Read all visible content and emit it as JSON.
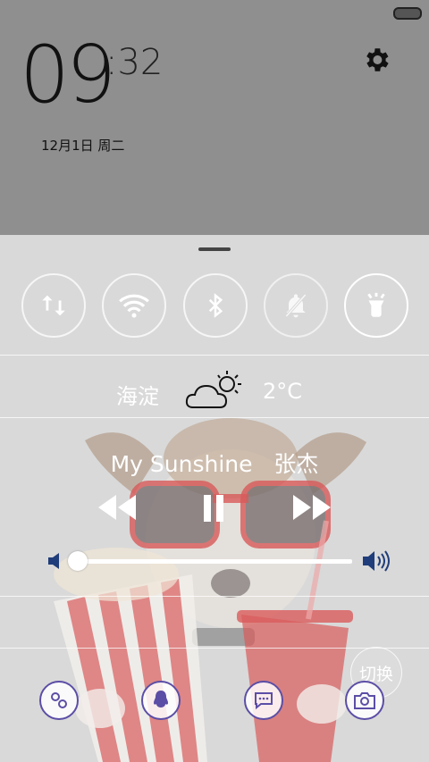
{
  "status_bar": {
    "battery": "battery-icon"
  },
  "clock": {
    "hours": "09",
    "minutes": ":32"
  },
  "date": "12月1日 周二",
  "toggles": [
    {
      "name": "sync",
      "icon": "sync-icon",
      "active": false
    },
    {
      "name": "wifi",
      "icon": "wifi-icon",
      "active": false
    },
    {
      "name": "bluetooth",
      "icon": "bluetooth-icon",
      "active": false
    },
    {
      "name": "silent",
      "icon": "bell-off-icon",
      "active": false
    },
    {
      "name": "flashlight",
      "icon": "flashlight-icon",
      "active": true
    }
  ],
  "weather": {
    "city": "海淀",
    "temperature": "2°C",
    "icon": "partly-cloudy-icon"
  },
  "music": {
    "title": "My Sunshine",
    "artist": "张杰",
    "song_line": "My Sunshine   张杰",
    "volume": 0.0
  },
  "switch_label": "切换",
  "dock": [
    {
      "name": "phone",
      "icon": "phone-icon"
    },
    {
      "name": "qq",
      "icon": "qq-penguin-icon"
    },
    {
      "name": "messages",
      "icon": "message-icon"
    },
    {
      "name": "camera",
      "icon": "camera-icon"
    }
  ],
  "colors": {
    "accent": "#5b4ea6",
    "panel": "#d9d9d9",
    "top": "#8f8f8f"
  }
}
